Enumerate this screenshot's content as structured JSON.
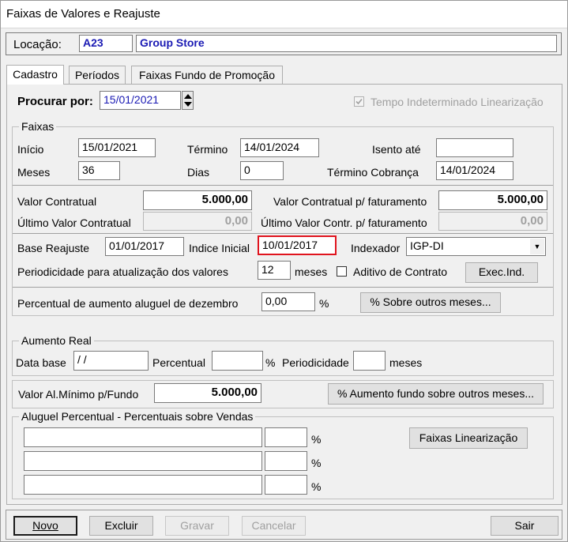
{
  "window": {
    "title": "Faixas de Valores e Reajuste"
  },
  "location": {
    "label": "Locação:",
    "code": "A23",
    "name": "Group Store"
  },
  "tabs": [
    {
      "label": "Cadastro",
      "active": true
    },
    {
      "label": "Períodos",
      "active": false
    },
    {
      "label": "Faixas Fundo de Promoção",
      "active": false
    }
  ],
  "search": {
    "label": "Procurar por:",
    "value": "15/01/2021"
  },
  "tempo": {
    "label": "Tempo Indeterminado Linearização",
    "checked": true
  },
  "faixas": {
    "group_label": "Faixas",
    "inicio_label": "Início",
    "inicio": "15/01/2021",
    "termino_label": "Término",
    "termino": "14/01/2024",
    "isento_label": "Isento até",
    "isento": "",
    "meses_label": "Meses",
    "meses": "36",
    "dias_label": "Dias",
    "dias": "0",
    "termino_cobranca_label": "Término Cobrança",
    "termino_cobranca": "14/01/2024",
    "valor_contratual_label": "Valor Contratual",
    "valor_contratual": "5.000,00",
    "valor_contratual_fat_label": "Valor Contratual p/ faturamento",
    "valor_contratual_fat": "5.000,00",
    "ultimo_valor_label": "Último Valor Contratual",
    "ultimo_valor": "0,00",
    "ultimo_valor_fat_label": "Último Valor Contr. p/ faturamento",
    "ultimo_valor_fat": "0,00",
    "base_reajuste_label": "Base Reajuste",
    "base_reajuste": "01/01/2017",
    "indice_inicial_label": "Indice Inicial",
    "indice_inicial": "10/01/2017",
    "indexador_label": "Indexador",
    "indexador": "IGP-DI",
    "periodicidade_label": "Periodicidade para atualização dos valores",
    "periodicidade": "12",
    "periodicidade_unit": "meses",
    "aditivo_label": "Aditivo de Contrato",
    "aditivo_checked": false,
    "exec_button": "Exec.Ind.",
    "percentual_dez_label": "Percentual de aumento aluguel de dezembro",
    "percentual_dez": "0,00",
    "percent_sign": "%",
    "outros_meses_button": "% Sobre outros meses..."
  },
  "aumento_real": {
    "group_label": "Aumento Real",
    "data_base_label": "Data base",
    "data_base": " / /",
    "percentual_label": "Percentual",
    "percentual": "",
    "percent_sign": "%",
    "periodicidade_label": "Periodicidade",
    "periodicidade": "",
    "meses_label": "meses"
  },
  "fundo": {
    "label": "Valor Al.Mínimo p/Fundo",
    "value": "5.000,00",
    "button": "% Aumento fundo sobre outros meses..."
  },
  "aluguel_percentual": {
    "group_label": "Aluguel Percentual - Percentuais sobre Vendas",
    "percent_sign": "%",
    "rows": [
      {
        "desc": "",
        "pct": ""
      },
      {
        "desc": "",
        "pct": ""
      },
      {
        "desc": "",
        "pct": ""
      }
    ],
    "button": "Faixas Linearização"
  },
  "footer": {
    "novo": "Novo",
    "excluir": "Excluir",
    "gravar": "Gravar",
    "cancelar": "Cancelar",
    "sair": "Sair"
  }
}
